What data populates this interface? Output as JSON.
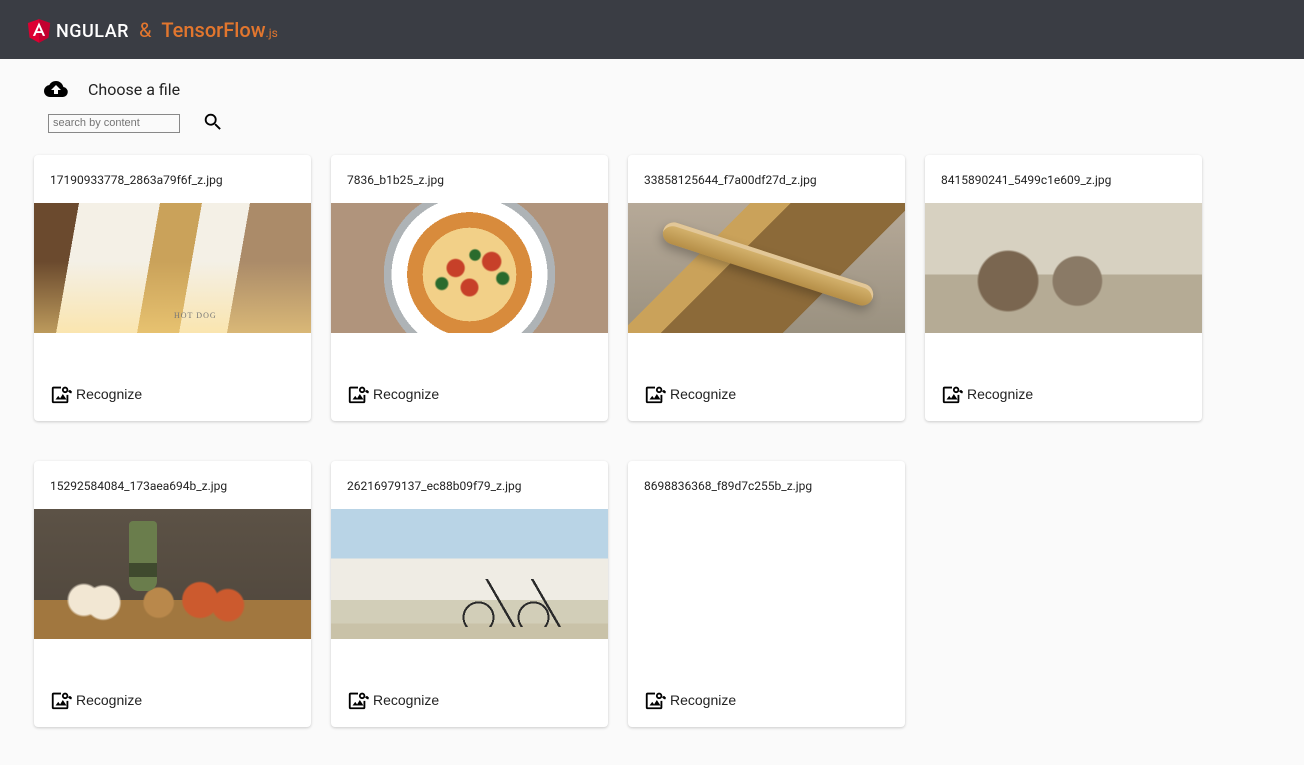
{
  "header": {
    "brand_angular_prefix_icon_alt": "Angular shield",
    "brand_angular_text": "NGULAR",
    "brand_separator": "&",
    "brand_tensorflow_text": "TensorFlow",
    "brand_tensorflow_suffix": ".js"
  },
  "controls": {
    "upload_label": "Choose a file",
    "search_placeholder": "search by content"
  },
  "recognize_label": "Recognize",
  "images": [
    {
      "filename": "17190933778_2863a79f6f_z.jpg",
      "thumb_class": "img-hotdog",
      "has_thumb": true
    },
    {
      "filename": "7836_b1b25_z.jpg",
      "thumb_class": "img-pizza",
      "has_thumb": true
    },
    {
      "filename": "33858125644_f7a00df27d_z.jpg",
      "thumb_class": "img-banana",
      "has_thumb": true
    },
    {
      "filename": "8415890241_5499c1e609_z.jpg",
      "thumb_class": "img-kittens",
      "has_thumb": true
    },
    {
      "filename": "15292584084_173aea694b_z.jpg",
      "thumb_class": "img-stilllife",
      "has_thumb": true
    },
    {
      "filename": "26216979137_ec88b09f79_z.jpg",
      "thumb_class": "img-bicycle",
      "has_thumb": true
    },
    {
      "filename": "8698836368_f89d7c255b_z.jpg",
      "thumb_class": "img-blank",
      "has_thumb": false
    }
  ]
}
